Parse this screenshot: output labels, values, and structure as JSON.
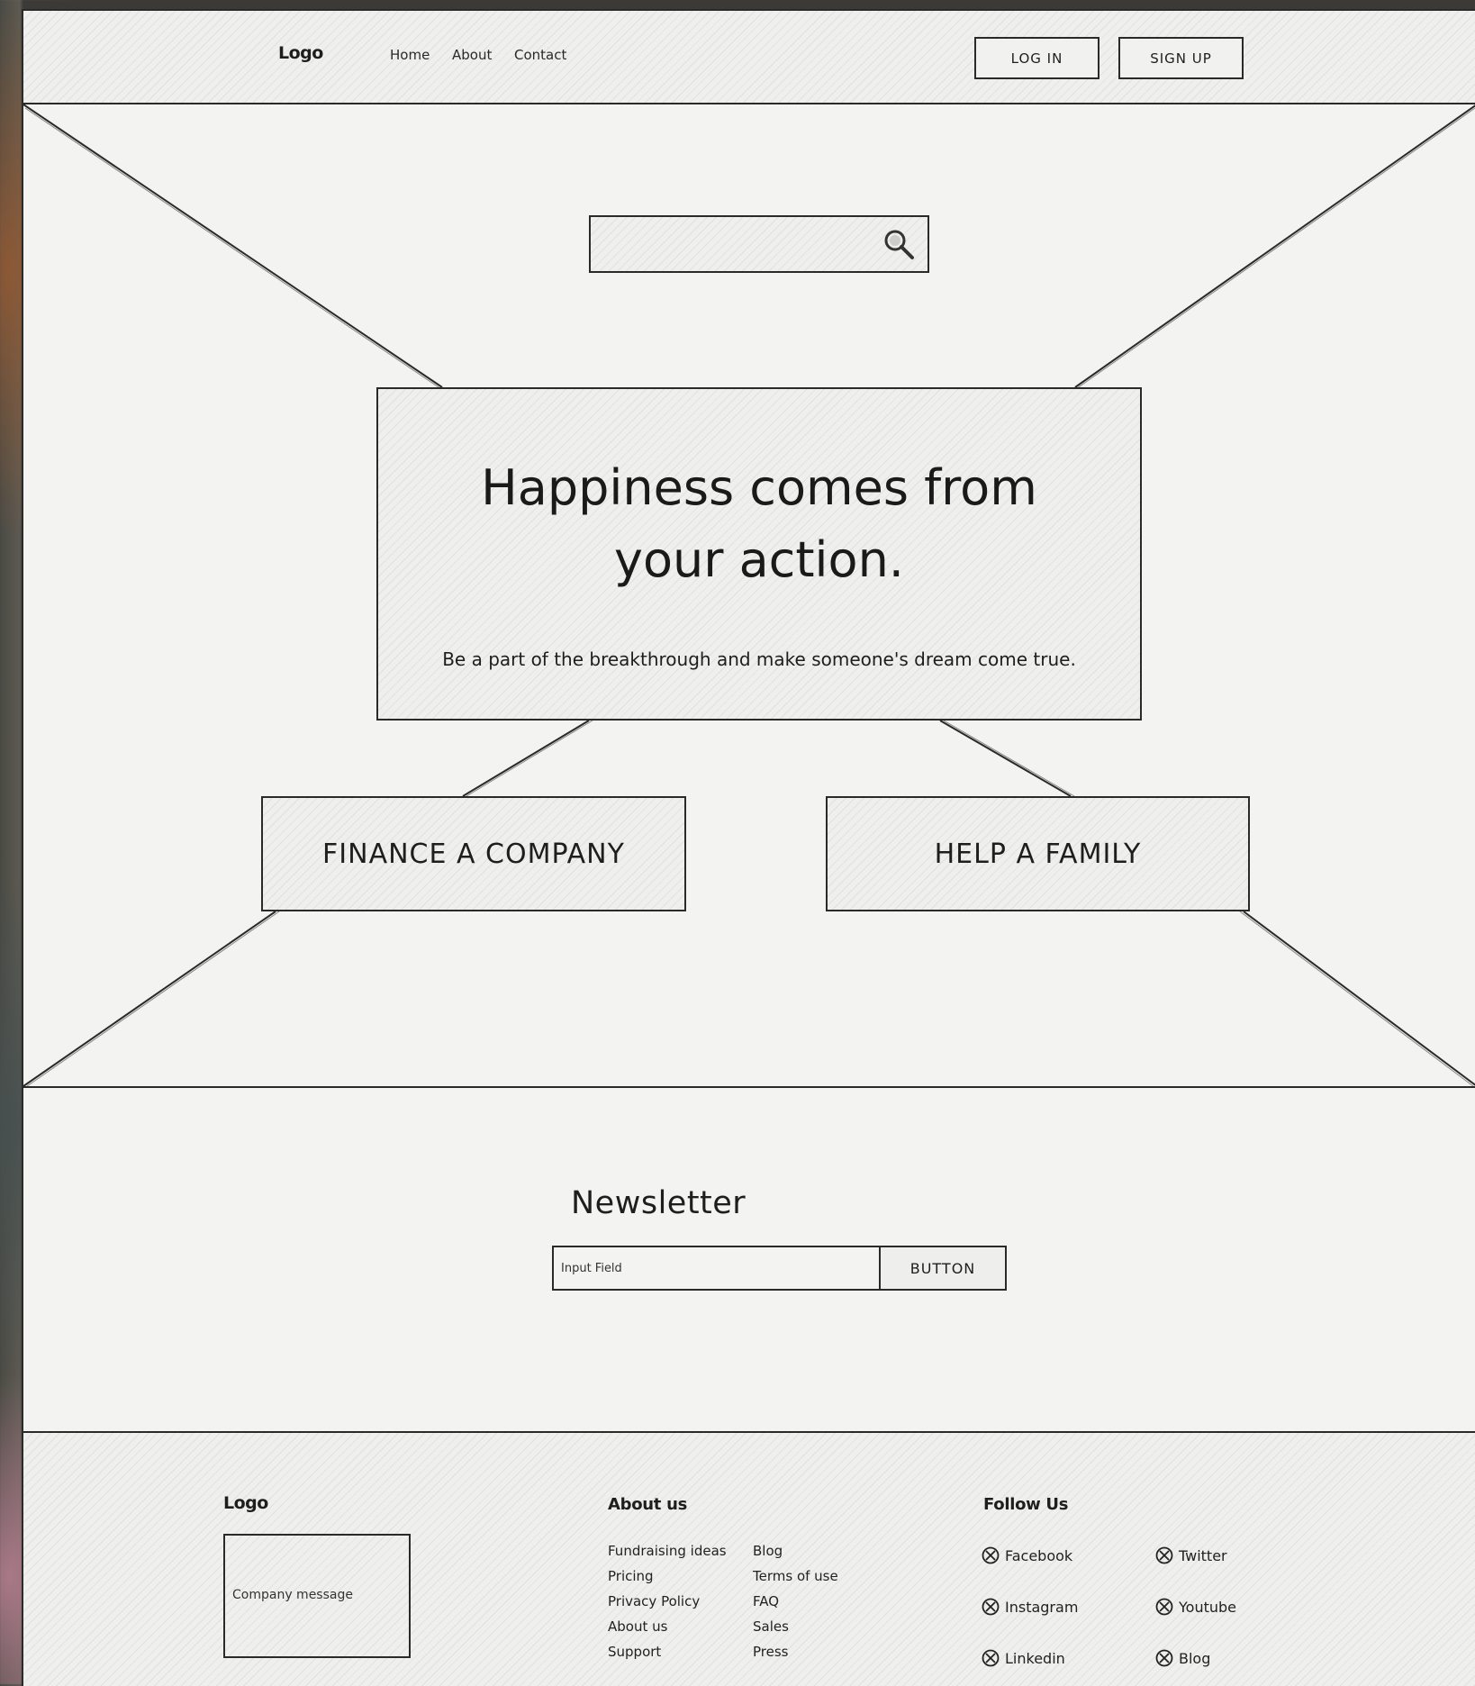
{
  "header": {
    "logo": "Logo",
    "nav": [
      "Home",
      "About",
      "Contact"
    ],
    "login_label": "LOG IN",
    "signup_label": "SIGN UP"
  },
  "hero": {
    "search": {
      "placeholder": ""
    },
    "headline_line1": "Happiness comes from",
    "headline_line2": "your action.",
    "subtext": "Be a part of the breakthrough and make someone's dream come true.",
    "cta_finance": "FINANCE A COMPANY",
    "cta_family": "HELP A FAMILY"
  },
  "newsletter": {
    "title": "Newsletter",
    "input_placeholder": "Input Field",
    "button_label": "BUTTON"
  },
  "footer": {
    "logo": "Logo",
    "company_message": "Company message",
    "about_heading": "About us",
    "about_col1": [
      "Fundraising ideas",
      "Pricing",
      "Privacy Policy",
      "About us",
      "Support"
    ],
    "about_col2": [
      "Blog",
      "Terms of use",
      "FAQ",
      "Sales",
      "Press"
    ],
    "follow_heading": "Follow Us",
    "social": [
      "Facebook",
      "Twitter",
      "Instagram",
      "Youtube",
      "Linkedin",
      "Blog"
    ]
  }
}
